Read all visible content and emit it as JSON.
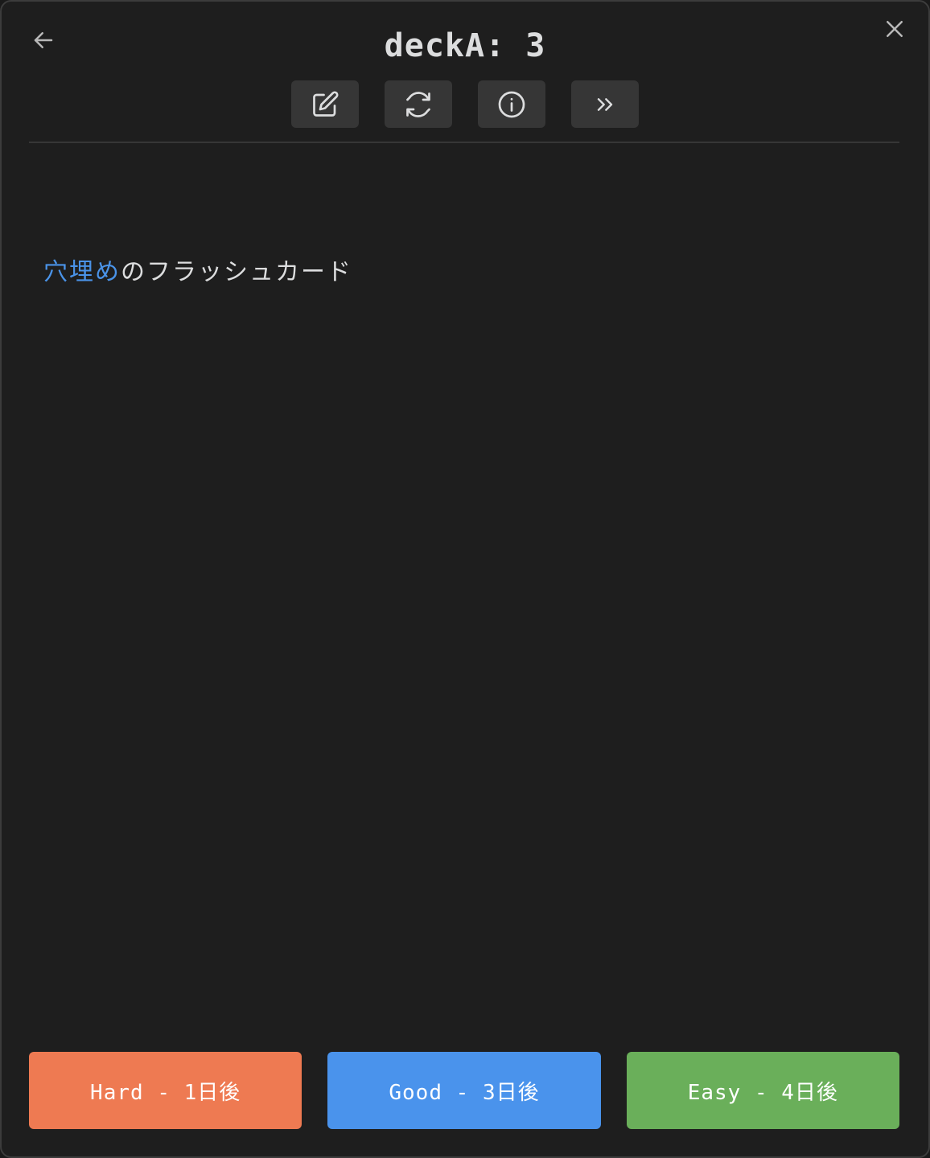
{
  "header": {
    "title": "deckA: 3",
    "back_icon": "arrow-left-icon",
    "close_icon": "close-icon"
  },
  "toolbar": {
    "buttons": [
      {
        "icon": "edit-icon"
      },
      {
        "icon": "refresh-icon"
      },
      {
        "icon": "info-icon"
      },
      {
        "icon": "skip-icon"
      }
    ]
  },
  "card": {
    "cloze_text": "穴埋め",
    "text": "のフラッシュカード",
    "cloze_color": "#4a93e8"
  },
  "answers": [
    {
      "label": "Hard - 1日後",
      "color": "#ee7a52"
    },
    {
      "label": "Good - 3日後",
      "color": "#4a93ec"
    },
    {
      "label": "Easy - 4日後",
      "color": "#6aaf5a"
    }
  ]
}
